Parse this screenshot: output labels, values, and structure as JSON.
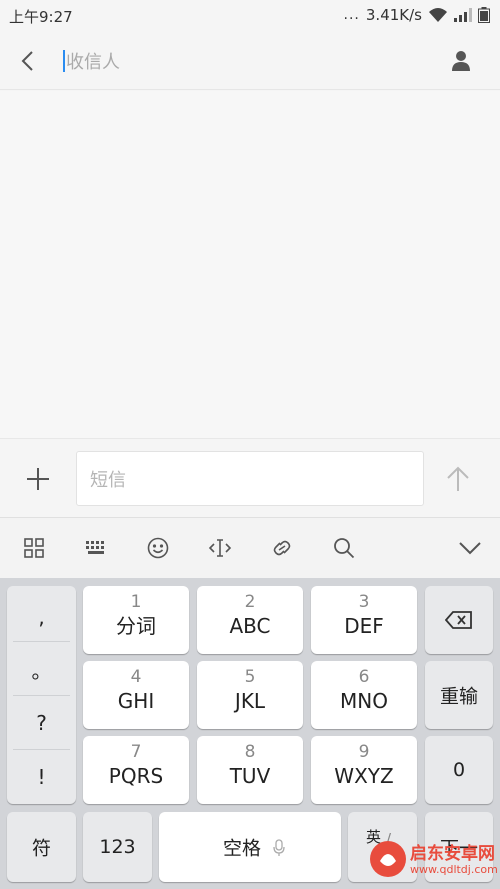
{
  "status_bar": {
    "time": "上午9:27",
    "dots": "...",
    "speed": "3.41K/s"
  },
  "header": {
    "recipient_placeholder": "收信人"
  },
  "compose": {
    "sms_placeholder": "短信"
  },
  "toolbar": {
    "icons": [
      "grid-icon",
      "keyboard-icon",
      "emoji-icon",
      "cursor-move-icon",
      "link-icon",
      "search-icon",
      "chevron-down-icon"
    ]
  },
  "keyboard": {
    "punctuation": [
      ",",
      "。",
      "?",
      "!"
    ],
    "keys": {
      "k1": {
        "num": "1",
        "label": "分词"
      },
      "k2": {
        "num": "2",
        "label": "ABC"
      },
      "k3": {
        "num": "3",
        "label": "DEF"
      },
      "k4": {
        "num": "4",
        "label": "GHI"
      },
      "k5": {
        "num": "5",
        "label": "JKL"
      },
      "k6": {
        "num": "6",
        "label": "MNO"
      },
      "k7": {
        "num": "7",
        "label": "PQRS"
      },
      "k8": {
        "num": "8",
        "label": "TUV"
      },
      "k9": {
        "num": "9",
        "label": "WXYZ"
      }
    },
    "reenter": "重输",
    "zero": "0",
    "symbol": "符",
    "numeric": "123",
    "space": "空格",
    "lang": "英",
    "lang_sub": "/",
    "next": "下一"
  },
  "watermark": {
    "name": "启东安卓网",
    "url": "www.qdltdj.com"
  },
  "colors": {
    "accent": "#2a8cf0",
    "watermark": "#e84c3d"
  }
}
